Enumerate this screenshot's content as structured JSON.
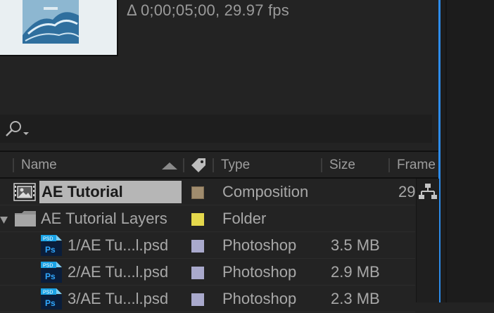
{
  "composition_info": "Δ 0;00;05;00, 29.97 fps",
  "columns": {
    "name": "Name",
    "type": "Type",
    "size": "Size",
    "frame": "Frame"
  },
  "rows": [
    {
      "name": "AE Tutorial",
      "type": "Composition",
      "size": "",
      "frame": "29",
      "label_color": "#a08c6e",
      "selected": true
    },
    {
      "name": "AE Tutorial Layers",
      "type": "Folder",
      "size": "",
      "frame": "",
      "label_color": "#e4d84c"
    },
    {
      "name": "1/AE Tu...l.psd",
      "type": "Photoshop",
      "size": "3.5 MB",
      "frame": "",
      "label_color": "#a9a9cc"
    },
    {
      "name": "2/AE Tu...l.psd",
      "type": "Photoshop",
      "size": "2.9 MB",
      "frame": "",
      "label_color": "#a9a9cc"
    },
    {
      "name": "3/AE Tu...l.psd",
      "type": "Photoshop",
      "size": "2.3 MB",
      "frame": "",
      "label_color": "#a9a9cc"
    }
  ],
  "icons": {
    "search": "search-icon",
    "label": "tag-icon",
    "sort": "sort-ascending-icon",
    "composition": "composition-icon",
    "folder": "folder-icon",
    "psd": "photoshop-file-icon",
    "flowchart": "flowchart-icon"
  },
  "psd_badge": "PSD",
  "ps_badge": "Ps"
}
